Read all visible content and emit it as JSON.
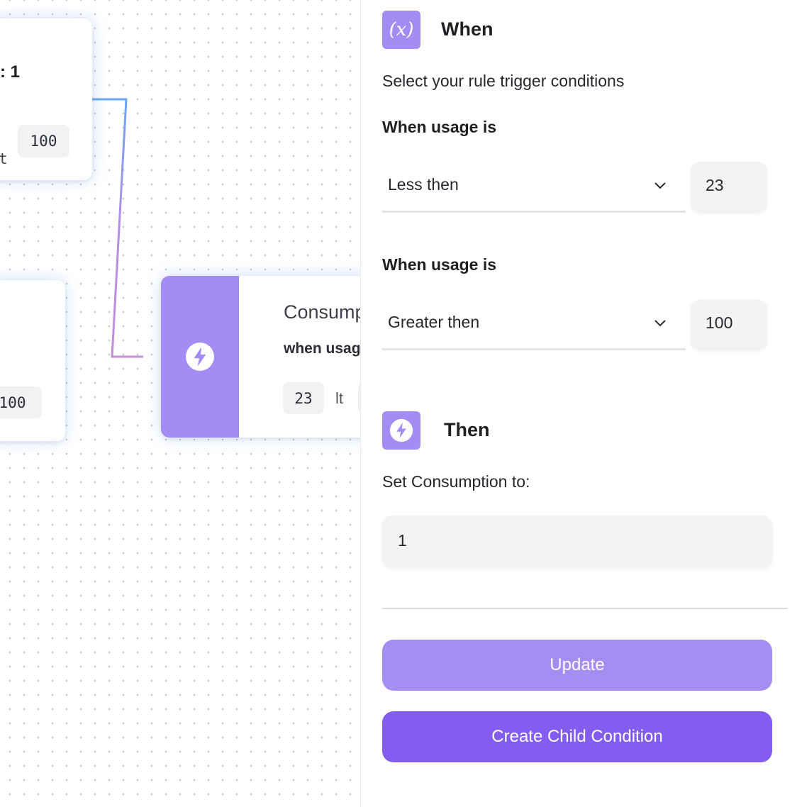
{
  "canvas": {
    "node1": {
      "title_fragment": ": 1",
      "lt_fragment": "t",
      "chip_value": "100"
    },
    "node2": {
      "chip_value": "100"
    },
    "node3": {
      "title": "Consump",
      "subtitle": "when usag",
      "chip_value": "23",
      "operator": "lt"
    }
  },
  "panel": {
    "when": {
      "icon": "variable-fx-icon",
      "title": "When",
      "description": "Select your rule trigger conditions",
      "conditions": [
        {
          "label": "When usage is",
          "operator": "Less then",
          "value": "23"
        },
        {
          "label": "When usage is",
          "operator": "Greater then",
          "value": "100"
        }
      ]
    },
    "then": {
      "icon": "lightning-icon",
      "title": "Then",
      "set_label": "Set Consumption to:",
      "set_value": "1"
    },
    "buttons": {
      "update": "Update",
      "create_child": "Create Child Condition"
    }
  },
  "colors": {
    "accent_light": "#a48ef2",
    "accent": "#845df0",
    "icon_bg": "#a38cf3",
    "edge_start": "#6aa5f5",
    "edge_end": "#c48ed8"
  }
}
